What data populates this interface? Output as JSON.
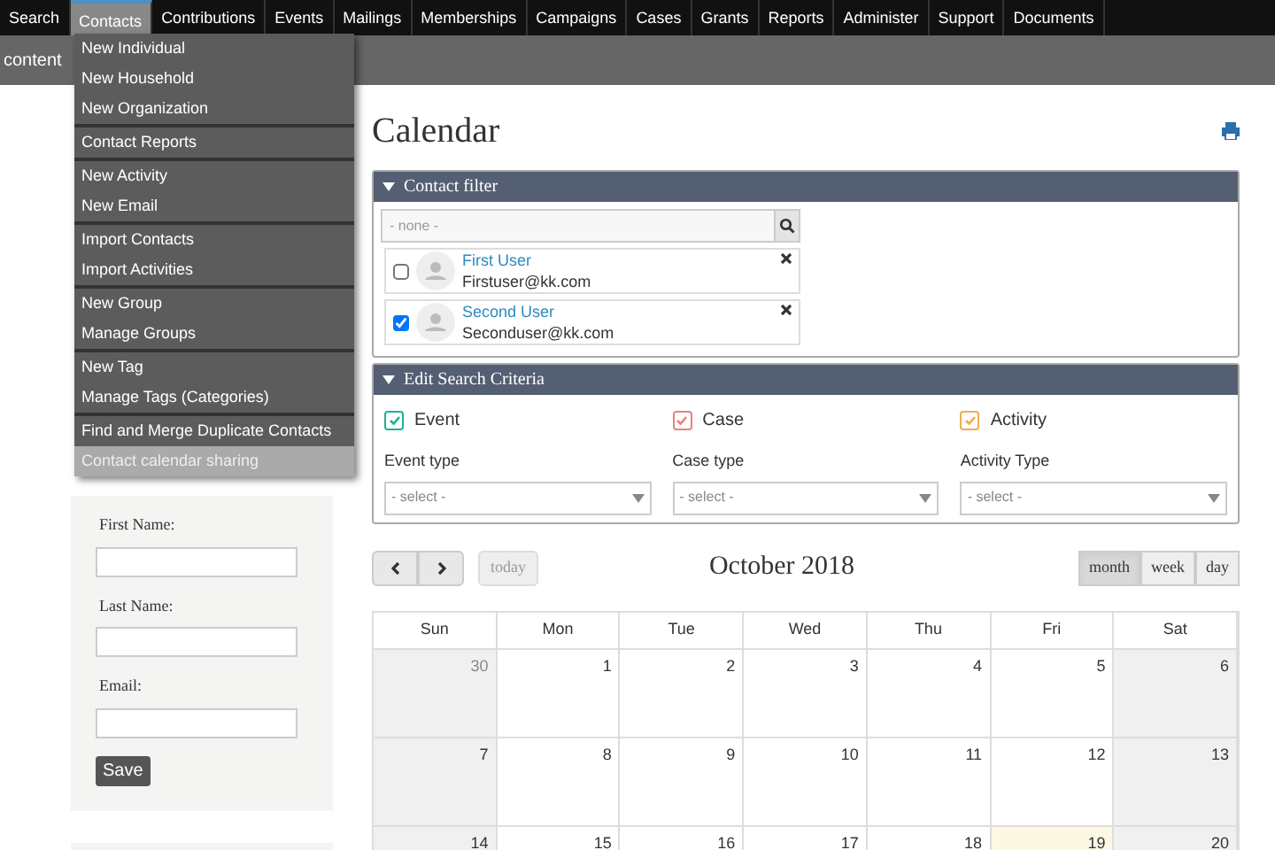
{
  "nav": [
    {
      "label": "Search",
      "selected": false
    },
    {
      "label": "Contacts",
      "selected": true
    },
    {
      "label": "Contributions",
      "selected": false
    },
    {
      "label": "Events",
      "selected": false
    },
    {
      "label": "Mailings",
      "selected": false
    },
    {
      "label": "Memberships",
      "selected": false
    },
    {
      "label": "Campaigns",
      "selected": false
    },
    {
      "label": "Cases",
      "selected": false
    },
    {
      "label": "Grants",
      "selected": false
    },
    {
      "label": "Reports",
      "selected": false
    },
    {
      "label": "Administer",
      "selected": false
    },
    {
      "label": "Support",
      "selected": false
    },
    {
      "label": "Documents",
      "selected": false
    }
  ],
  "subbar": {
    "label": "content"
  },
  "contacts_menu": [
    [
      {
        "label": "New Individual",
        "selected": false
      },
      {
        "label": "New Household",
        "selected": false
      },
      {
        "label": "New Organization",
        "selected": false
      }
    ],
    [
      {
        "label": "Contact Reports",
        "selected": false
      }
    ],
    [
      {
        "label": "New Activity",
        "selected": false
      },
      {
        "label": "New Email",
        "selected": false
      }
    ],
    [
      {
        "label": "Import Contacts",
        "selected": false
      },
      {
        "label": "Import Activities",
        "selected": false
      }
    ],
    [
      {
        "label": "New Group",
        "selected": false
      },
      {
        "label": "Manage Groups",
        "selected": false
      }
    ],
    [
      {
        "label": "New Tag",
        "selected": false
      },
      {
        "label": "Manage Tags (Categories)",
        "selected": false
      }
    ],
    [
      {
        "label": "Find and Merge Duplicate Contacts",
        "selected": false
      },
      {
        "label": "Contact calendar sharing",
        "selected": true
      }
    ]
  ],
  "sidebar": {
    "fields": [
      {
        "label": "First Name:"
      },
      {
        "label": "Last Name:"
      },
      {
        "label": "Email:"
      }
    ],
    "save_button": "Save"
  },
  "page_title": "Calendar",
  "contact_filter": {
    "title": "Contact filter",
    "placeholder": "- none -",
    "contacts": [
      {
        "name": "First User",
        "email": "Firstuser@kk.com",
        "checked": false
      },
      {
        "name": "Second User",
        "email": "Seconduser@kk.com",
        "checked": true
      }
    ]
  },
  "search_criteria": {
    "title": "Edit Search Criteria",
    "types": [
      {
        "label": "Event",
        "checked": true,
        "color": "#1ab394",
        "select_label": "Event type",
        "placeholder": "- select -"
      },
      {
        "label": "Case",
        "checked": true,
        "color": "#e8817f",
        "select_label": "Case type",
        "placeholder": "- select -"
      },
      {
        "label": "Activity",
        "checked": true,
        "color": "#f0ad4e",
        "select_label": "Activity Type",
        "placeholder": "- select -"
      }
    ]
  },
  "calendar": {
    "today_button": "today",
    "title": "October 2018",
    "views": [
      {
        "label": "month",
        "selected": true
      },
      {
        "label": "week",
        "selected": false
      },
      {
        "label": "day",
        "selected": false
      }
    ],
    "weekdays": [
      "Sun",
      "Mon",
      "Tue",
      "Wed",
      "Thu",
      "Fri",
      "Sat"
    ],
    "weeks": [
      [
        {
          "day": "30",
          "other_month": true,
          "today": false
        },
        {
          "day": "1",
          "other_month": false,
          "today": false
        },
        {
          "day": "2",
          "other_month": false,
          "today": false
        },
        {
          "day": "3",
          "other_month": false,
          "today": false
        },
        {
          "day": "4",
          "other_month": false,
          "today": false
        },
        {
          "day": "5",
          "other_month": false,
          "today": false
        },
        {
          "day": "6",
          "other_month": false,
          "today": false
        }
      ],
      [
        {
          "day": "7",
          "other_month": false,
          "today": false
        },
        {
          "day": "8",
          "other_month": false,
          "today": false
        },
        {
          "day": "9",
          "other_month": false,
          "today": false
        },
        {
          "day": "10",
          "other_month": false,
          "today": false
        },
        {
          "day": "11",
          "other_month": false,
          "today": false
        },
        {
          "day": "12",
          "other_month": false,
          "today": false
        },
        {
          "day": "13",
          "other_month": false,
          "today": false
        }
      ],
      [
        {
          "day": "14",
          "other_month": false,
          "today": false
        },
        {
          "day": "15",
          "other_month": false,
          "today": false
        },
        {
          "day": "16",
          "other_month": false,
          "today": false
        },
        {
          "day": "17",
          "other_month": false,
          "today": false
        },
        {
          "day": "18",
          "other_month": false,
          "today": false
        },
        {
          "day": "19",
          "other_month": false,
          "today": true
        },
        {
          "day": "20",
          "other_month": false,
          "today": false
        }
      ]
    ]
  }
}
